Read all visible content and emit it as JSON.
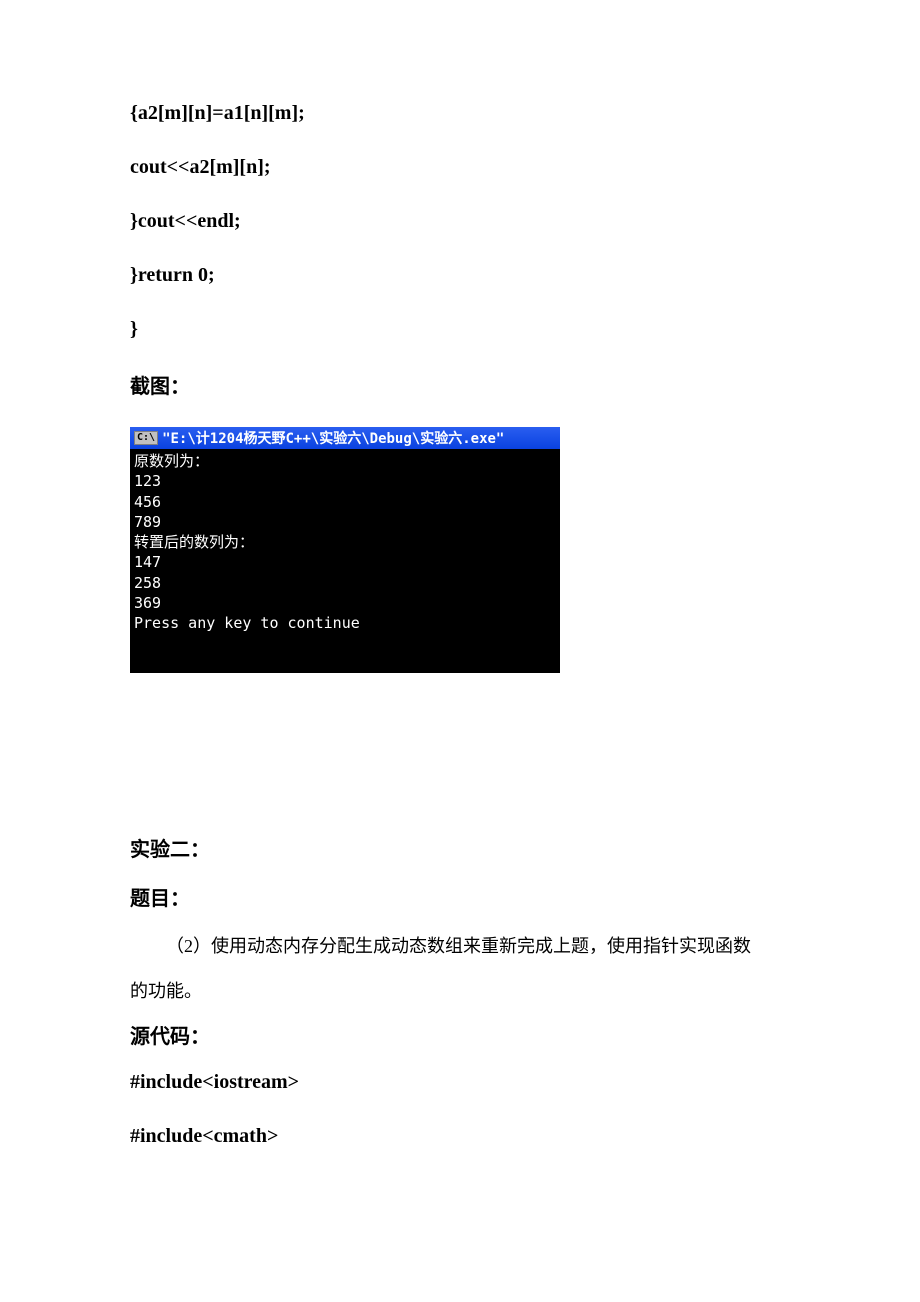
{
  "code": {
    "line1": "{a2[m][n]=a1[n][m];",
    "line2": "cout<<a2[m][n];",
    "line3": "}cout<<endl;",
    "line4": "}return 0;",
    "line5": "}"
  },
  "screenshot_label": "截图：",
  "terminal": {
    "icon": "C:\\",
    "title": "\"E:\\计1204杨天野C++\\实验六\\Debug\\实验六.exe\"",
    "output": "原数列为：\n123\n456\n789\n转置后的数列为：\n147\n258\n369\nPress any key to continue"
  },
  "section2": {
    "title": "实验二：",
    "subtitle": "题目：",
    "description_line1": "（2）使用动态内存分配生成动态数组来重新完成上题，使用指针实现函数",
    "description_line2": "的功能。",
    "source_label": "源代码：",
    "code_line1": "#include<iostream>",
    "code_line2": "#include<cmath>"
  }
}
